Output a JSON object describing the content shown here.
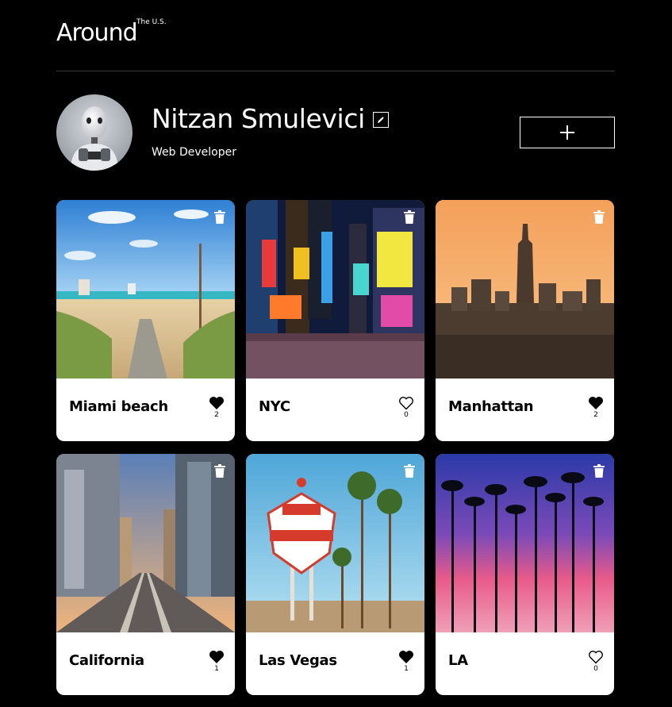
{
  "header": {
    "logo": "Around",
    "logo_sup": "The U.S."
  },
  "profile": {
    "name": "Nitzan Smulevici",
    "job": "Web Developer"
  },
  "cards": [
    {
      "title": "Miami beach",
      "likes": "2",
      "liked": true
    },
    {
      "title": "NYC",
      "likes": "0",
      "liked": false
    },
    {
      "title": "Manhattan",
      "likes": "2",
      "liked": true
    },
    {
      "title": "California",
      "likes": "1",
      "liked": true
    },
    {
      "title": "Las Vegas",
      "likes": "1",
      "liked": true
    },
    {
      "title": "LA",
      "likes": "0",
      "liked": false
    }
  ],
  "icons": {
    "edit": "pencil-icon",
    "add": "plus-icon",
    "delete": "trash-icon",
    "like": "heart-icon"
  },
  "colors": {
    "background": "#000000",
    "card": "#ffffff",
    "text": "#ffffff",
    "card_text": "#000000"
  }
}
